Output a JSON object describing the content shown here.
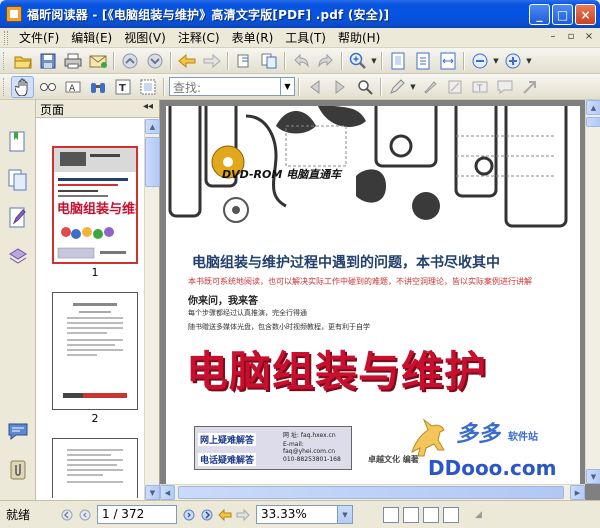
{
  "window": {
    "title": "福昕阅读器 - [《电脑组装与维护》高清文字版[PDF] .pdf (安全)]",
    "buttons": {
      "minimize": "_",
      "maximize": "□",
      "close": "×"
    }
  },
  "menu": {
    "items": [
      "文件(F)",
      "编辑(E)",
      "视图(V)",
      "注释(C)",
      "表单(R)",
      "工具(T)",
      "帮助(H)"
    ],
    "doc_controls": [
      "–",
      "▫",
      "×"
    ]
  },
  "toolbar": {
    "search_placeholder": "查找:"
  },
  "thumbnail_panel": {
    "header": "页面",
    "collapse_glyph": "◂◂",
    "thumbnails": [
      {
        "label": "1",
        "selected": true
      },
      {
        "label": "2",
        "selected": false
      }
    ]
  },
  "page_content": {
    "dvd_label": "DVD-ROM 电脑直通车",
    "headline": "电脑组装与维护过程中遇到的问题，本书尽收其中",
    "red_subline": "本书既可系统地阅读，也可以解决实际工作中碰到的难题，不讲空洞理论，皆以实际案例进行讲解",
    "bold_line": "你来问，我来答",
    "line2": "每个步骤都经过认真推演，完全行得通",
    "line3": "随书赠送多媒体光盘，包含数小时视频教程，更有利于自学",
    "big_title": "电脑组装与维护",
    "box": {
      "label1": "网上疑难解答",
      "label2": "电话疑难解答",
      "url": "网 址: faq.hxex.cn",
      "email": "E-mail: faq@yhei.com.cn",
      "phone": "010-88253801-168"
    },
    "publisher": "卓越文化  编著",
    "watermark": {
      "brand": "多多",
      "site": "软件站",
      "url": "DDooo.com"
    }
  },
  "status": {
    "text": "就绪",
    "page_display": "1 / 372",
    "zoom": "33.33%"
  }
}
